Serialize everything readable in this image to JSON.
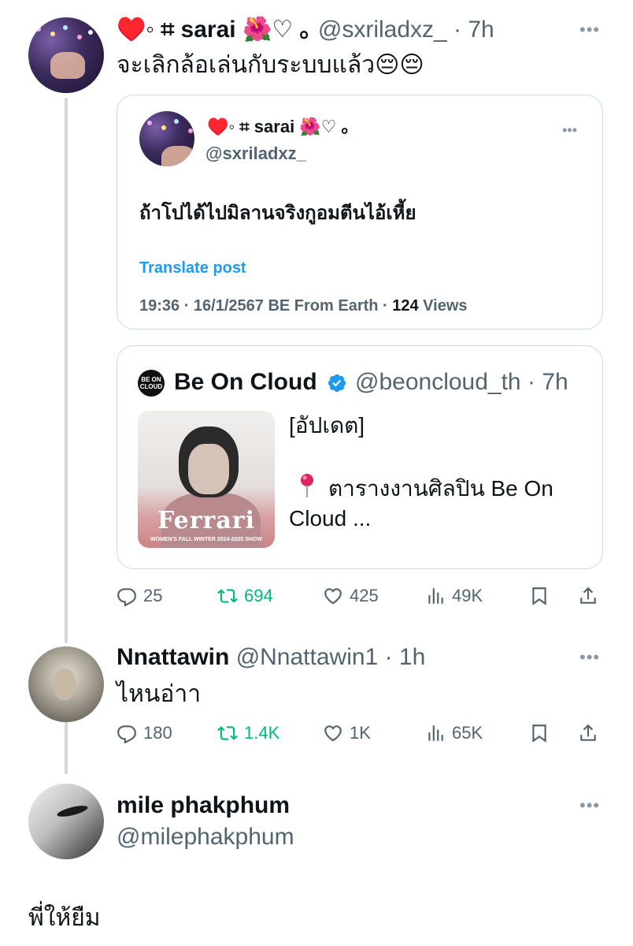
{
  "tweet1": {
    "name": "♥️◦ ⌗ sarai 🌺♡ ｡",
    "handle": "@sxriladxz_",
    "time": "· 7h",
    "text": "จะเลิกล้อเล่นกับระบบแล้ว😔😔",
    "quote": {
      "name": "♥️◦ ⌗ sarai 🌺♡ ｡",
      "handle": "@sxriladxz_",
      "text": "ถ้าโปได้ไปมิลานจริงกูอมตีนไอ้เหี้ย",
      "translate": "Translate post",
      "meta_prefix": "19:36 · 16/1/2567 BE From Earth · ",
      "views_count": "124",
      "views_label": " Views"
    },
    "embed": {
      "logo_text": "BE ON CLOUD",
      "name": "Be On Cloud",
      "handle": "@beoncloud_th · 7h",
      "line1": "[อัปเดต]",
      "line2": "ตารางงานศิลปิน Be On",
      "line3": "Cloud ...",
      "thumb_brand": "Ferrari",
      "thumb_sub": "WOMEN'S FALL WINTER 2024-2025 SHOW"
    },
    "actions": {
      "replies": "25",
      "retweets": "694",
      "likes": "425",
      "views": "49K"
    }
  },
  "tweet2": {
    "name": "Nnattawin",
    "handle": "@Nnattawin1",
    "time": "· 1h",
    "text": "ไหนอ่าา",
    "actions": {
      "replies": "180",
      "retweets": "1.4K",
      "likes": "1K",
      "views": "65K"
    }
  },
  "tweet3": {
    "name": "mile phakphum",
    "handle": "@milephakphum",
    "text": "พี่ให้ยืม"
  },
  "icons": {
    "more": "more-icon",
    "reply": "reply-icon",
    "retweet": "retweet-icon",
    "like": "heart-icon",
    "views": "views-icon",
    "bookmark": "bookmark-icon",
    "share": "share-icon",
    "verified": "verified-badge-icon"
  },
  "colors": {
    "accent": "#1d9bf0",
    "retweet": "#00ba7c",
    "muted": "#536471",
    "border": "#cfd9de"
  }
}
